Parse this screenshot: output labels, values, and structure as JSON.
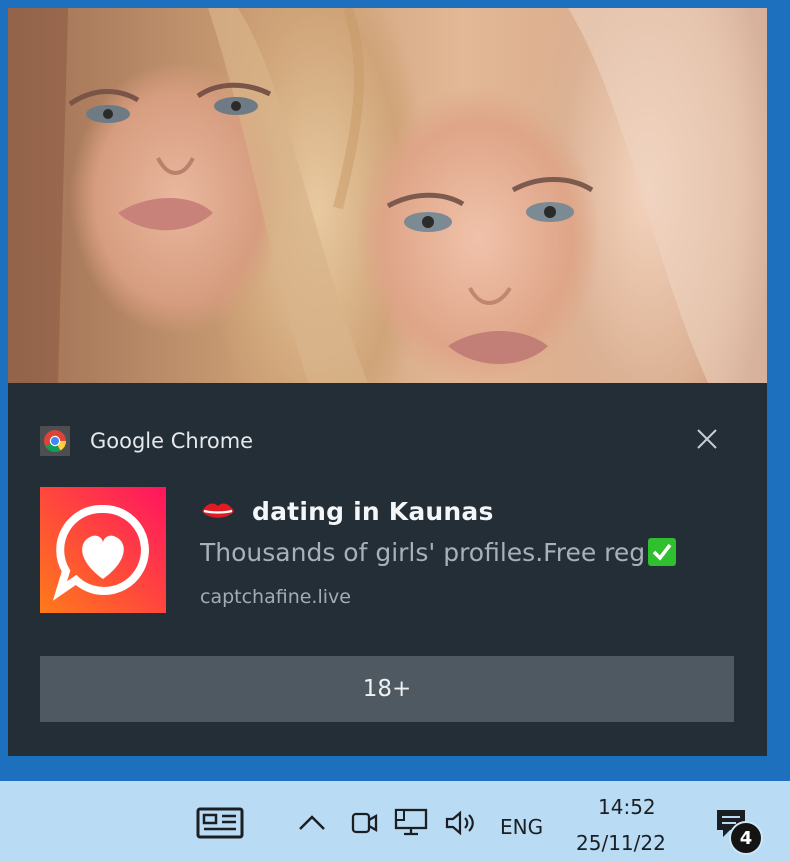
{
  "notification": {
    "app_name": "Google Chrome",
    "title": "dating in Kaunas",
    "body": "Thousands of girls' profiles.Free reg",
    "source": "captchafine.live",
    "action_label": "18+",
    "hero_image": "photo-of-two-blonde-women",
    "icons": {
      "app": "chrome-logo-icon",
      "tile": "chat-heart-icon",
      "title_emoji": "lips-icon",
      "body_emoji": "check-mark-icon",
      "close": "close-icon"
    },
    "colors": {
      "toast_bg": "#232e37",
      "button_bg": "#4f5961",
      "tile_gradient_start": "#ff7a1a",
      "tile_gradient_end": "#ff1460",
      "check_green": "#2fbf2f"
    }
  },
  "taskbar": {
    "time": "14:52",
    "date": "25/11/22",
    "language": "ENG",
    "notification_count": "4",
    "icons": [
      "news-widget-icon",
      "chevron-up-icon",
      "camera-icon",
      "network-icon",
      "volume-icon",
      "action-center-icon"
    ],
    "background": "#b9dcf4"
  }
}
